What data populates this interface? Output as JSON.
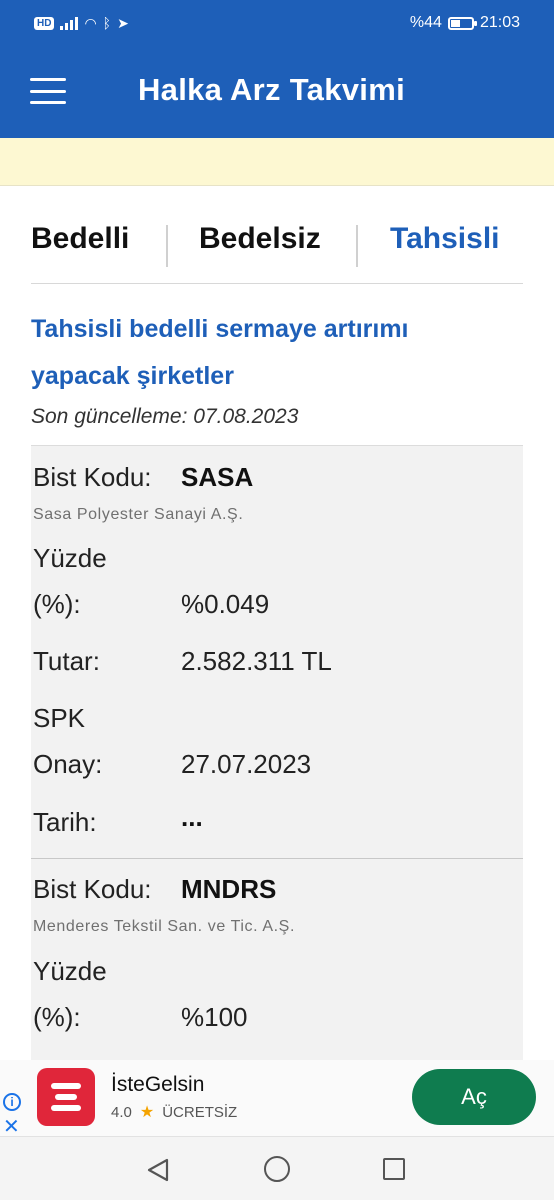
{
  "status_bar": {
    "network_badge": "HD",
    "battery": "%44",
    "battery_level": 0.44,
    "time": "21:03"
  },
  "app_bar": {
    "title": "Halka Arz Takvimi",
    "menu_icon": "hamburger-menu-icon"
  },
  "tabs": [
    {
      "label": "Bedelli",
      "active": false
    },
    {
      "label": "Bedelsiz",
      "active": false
    },
    {
      "label": "Tahsisli",
      "active": true
    }
  ],
  "section": {
    "heading_line1": "Tahsisli bedelli sermaye artırımı",
    "heading_line2": "yapacak şirketler",
    "updated": "Son güncelleme: 07.08.2023"
  },
  "labels": {
    "bist_kodu": "Bist Kodu:",
    "yuzde_1": "Yüzde",
    "yuzde_2": "(%):",
    "tutar": "Tutar:",
    "spk_1": "SPK",
    "spk_2": "Onay:",
    "spk_3": "Tarih:"
  },
  "companies": [
    {
      "code": "SASA",
      "name": "Sasa Polyester Sanayi A.Ş.",
      "yuzde": "%0.049",
      "tutar": "2.582.311 TL",
      "spk_onay": "27.07.2023",
      "tarih": "..."
    },
    {
      "code": "MNDRS",
      "name": "Menderes Tekstil San. ve Tic. A.Ş.",
      "yuzde": "%100"
    }
  ],
  "ad": {
    "app_name": "İsteGelsin",
    "rating": "4.0",
    "price": "ÜCRETSİZ",
    "button": "Aç",
    "button_color": "#0f7c4f"
  },
  "colors": {
    "primary": "#1e5fb8",
    "banner": "#fdf8d2"
  }
}
